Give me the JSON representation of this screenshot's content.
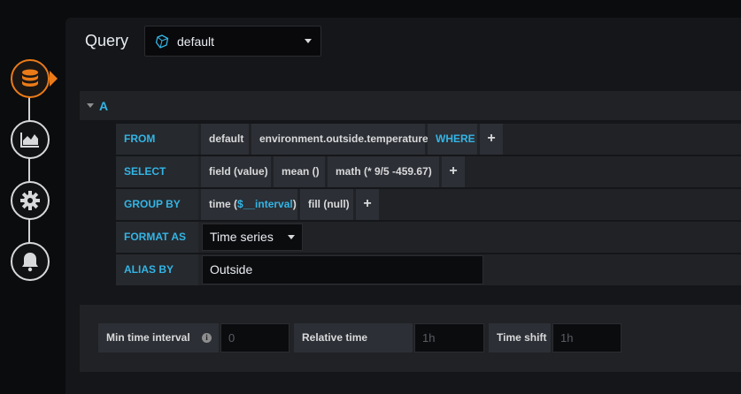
{
  "header": {
    "query_label": "Query",
    "datasource": {
      "name": "default",
      "icon": "influxdb-icon"
    }
  },
  "rail": {
    "items": [
      {
        "name": "queries",
        "icon": "database-icon",
        "active": true
      },
      {
        "name": "visualization",
        "icon": "chart-area-icon",
        "active": false
      },
      {
        "name": "general",
        "icon": "gear-icon",
        "active": false
      },
      {
        "name": "alert",
        "icon": "bell-icon",
        "active": false
      }
    ],
    "accent": "#eb7b18"
  },
  "query": {
    "ref_id": "A",
    "from": {
      "keyword": "FROM",
      "policy": "default",
      "measurement": "environment.outside.temperature",
      "where_keyword": "WHERE",
      "add": "+"
    },
    "select": {
      "keyword": "SELECT",
      "parts": [
        "field (value)",
        "mean ()",
        "math (* 9/5 -459.67)"
      ],
      "add": "+"
    },
    "group_by": {
      "keyword": "GROUP BY",
      "time_prefix": "time (",
      "time_var": "$__interval",
      "time_suffix": ")",
      "fill": "fill (null)",
      "add": "+"
    },
    "format_as": {
      "keyword": "FORMAT AS",
      "value": "Time series"
    },
    "alias_by": {
      "keyword": "ALIAS BY",
      "value": "Outside"
    }
  },
  "options": {
    "min_interval": {
      "label": "Min time interval",
      "placeholder": "0"
    },
    "relative_time": {
      "label": "Relative time",
      "placeholder": "1h"
    },
    "time_shift": {
      "label": "Time shift",
      "placeholder": "1h"
    }
  },
  "colors": {
    "keyword": "#33b5e5",
    "accent": "#eb7b18"
  }
}
